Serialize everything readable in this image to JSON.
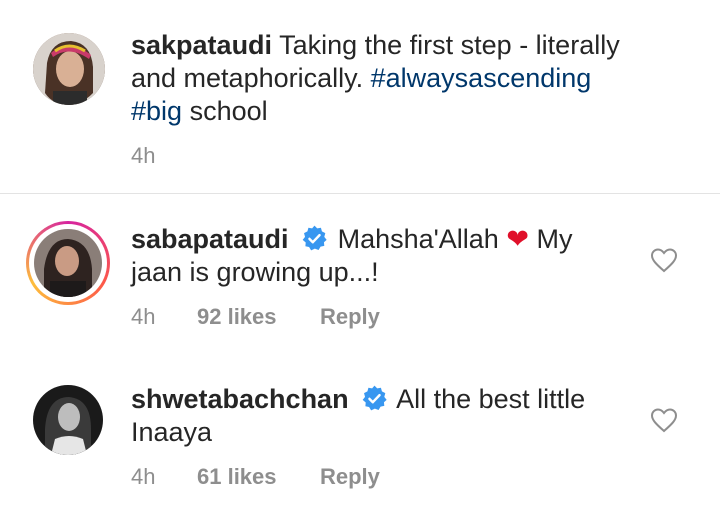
{
  "caption": {
    "username": "sakpataudi",
    "text_line1": "Taking the first step - literally",
    "text_line2": "and metaphorically.",
    "hashtag1": "#alwaysascending",
    "hashtag2": "#big",
    "text_line3_tail": "school",
    "time": "4h"
  },
  "comments": [
    {
      "username": "sabapataudi",
      "verified": true,
      "text_before_emoji": "Mahsha'Allah",
      "emoji": "❤",
      "text_after_emoji": "My",
      "text_line2": "jaan is growing up...!",
      "time": "4h",
      "likes": "92 likes",
      "reply": "Reply"
    },
    {
      "username": "shwetabachchan",
      "verified": true,
      "text_line1": "All the best little",
      "text_line2": "Inaaya",
      "time": "4h",
      "likes": "61 likes",
      "reply": "Reply"
    }
  ],
  "colors": {
    "hashtag": "#00376b",
    "verified": "#3897f0",
    "meta": "#8e8e8e",
    "heart": "#e0102a"
  },
  "icons": {
    "verified": "verified-badge-icon",
    "like": "heart-outline-icon",
    "emoji": "red-heart-emoji"
  }
}
